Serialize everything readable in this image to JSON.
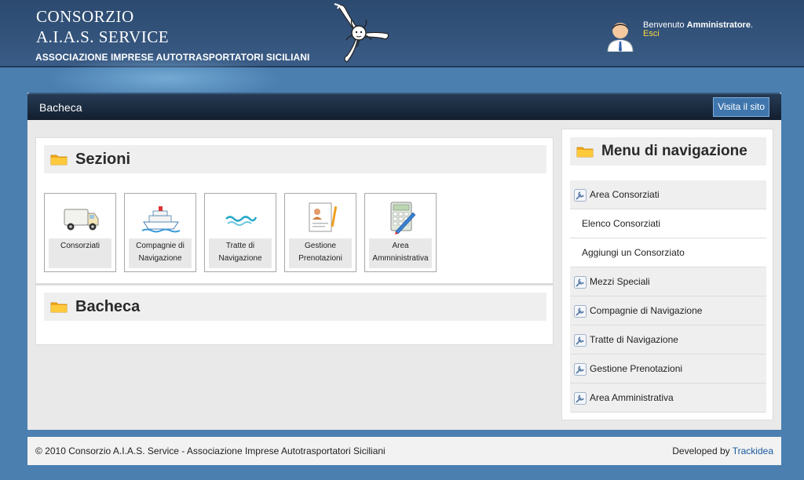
{
  "header": {
    "brand_line1": "CONSORZIO",
    "brand_line2": "A.I.A.S. SERVICE",
    "tagline": "ASSOCIAZIONE IMPRESE AUTOTRASPORTATORI SICILIANI",
    "welcome_prefix": "Benvenuto ",
    "user_name": "Amministratore",
    "welcome_suffix": ".",
    "logout_label": "Esci"
  },
  "panel": {
    "title": "Bacheca",
    "visit_site_label": "Visita il sito"
  },
  "sections": {
    "heading": "Sezioni",
    "tiles": [
      {
        "label": "Consorziati",
        "icon": "truck-icon"
      },
      {
        "label": "Compagnie di Navigazione",
        "icon": "ship-icon"
      },
      {
        "label": "Tratte di Navigazione",
        "icon": "waves-icon"
      },
      {
        "label": "Gestione Prenotazioni",
        "icon": "document-user-icon"
      },
      {
        "label": "Area Ammninistrativa",
        "icon": "calculator-icon"
      }
    ]
  },
  "board": {
    "heading": "Bacheca"
  },
  "nav_menu": {
    "heading": "Menu di navigazione",
    "items": [
      {
        "label": "Area Consorziati",
        "type": "main"
      },
      {
        "label": "Elenco Consorziati",
        "type": "sub"
      },
      {
        "label": "Aggiungi un Consorziato",
        "type": "sub"
      },
      {
        "label": "Mezzi Speciali",
        "type": "main"
      },
      {
        "label": "Compagnie di Navigazione",
        "type": "main"
      },
      {
        "label": "Tratte di Navigazione",
        "type": "main"
      },
      {
        "label": "Gestione Prenotazioni",
        "type": "main"
      },
      {
        "label": "Area Amministrativa",
        "type": "main"
      }
    ]
  },
  "footer": {
    "copyright": "© 2010 Consorzio A.I.A.S. Service - Associazione Imprese Autotrasportatori Siciliani",
    "developed_by": "Developed by ",
    "developer_link": "Trackidea"
  },
  "colors": {
    "page_background": "#4a7fb0",
    "header": "#34547c",
    "panel_bar": "#1a2a40",
    "logout_link": "#ffd83c",
    "accent_button": "#3f76ad"
  }
}
